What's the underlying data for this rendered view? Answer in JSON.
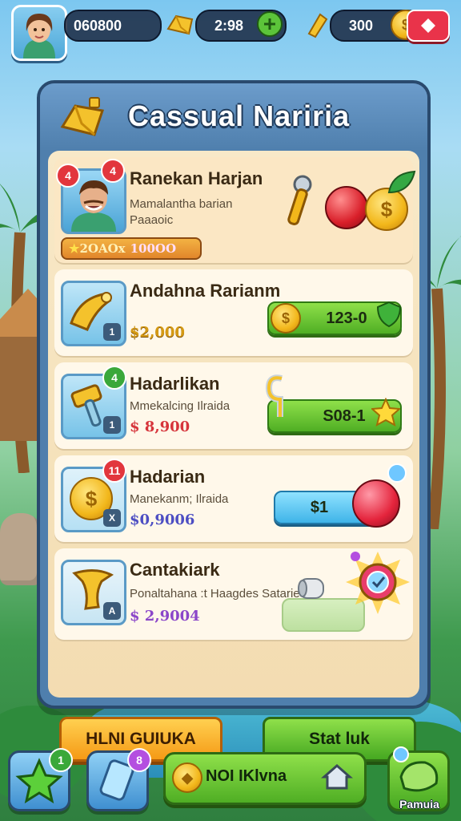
{
  "hud": {
    "stat1": "060800",
    "stat2": "2:98",
    "stat3": "300"
  },
  "panel": {
    "title": "Cassual Nariria"
  },
  "items": [
    {
      "title": "Ranekan Harjan",
      "subtitle": "Mamalantha barian",
      "subtitle2": "Paaaoic",
      "badge": "4",
      "badge_left": "4",
      "pill_a": "2OAOx",
      "pill_b": "100OO"
    },
    {
      "title": "Andahna Rarianm",
      "price": "$2,000",
      "thumb_mark": "1",
      "button_label": "123-0"
    },
    {
      "title": "Hadarlikan",
      "subtitle": "Mmekalcing Ilraida",
      "price": "$ 8,900",
      "thumb_mark": "1",
      "badge": "4",
      "button_label": "S08-1"
    },
    {
      "title": "Hadarian",
      "subtitle": "Manekanm; Ilraida",
      "price": "$0,9006",
      "thumb_mark": "X",
      "badge": "11",
      "button_label": "$1"
    },
    {
      "title": "Cantakiark",
      "subtitle": "Ponaltahana :t Haagdes Satarie",
      "price": "$ 2,9004",
      "thumb_mark": "A"
    }
  ],
  "buttons": {
    "left": "HLNI GUIUKA",
    "right": "Stat luk"
  },
  "bottom_bar": {
    "star_badge": "1",
    "tab_badge": "8",
    "main_label": "NOI IKlvna",
    "right_label": "Pamuia"
  },
  "colors": {
    "panel_blue": "#4f7fad",
    "buy_green": "#4fae24",
    "buy_blue": "#3fb4e8",
    "orange_button": "#f59a16",
    "badge_red": "#e2363d"
  }
}
